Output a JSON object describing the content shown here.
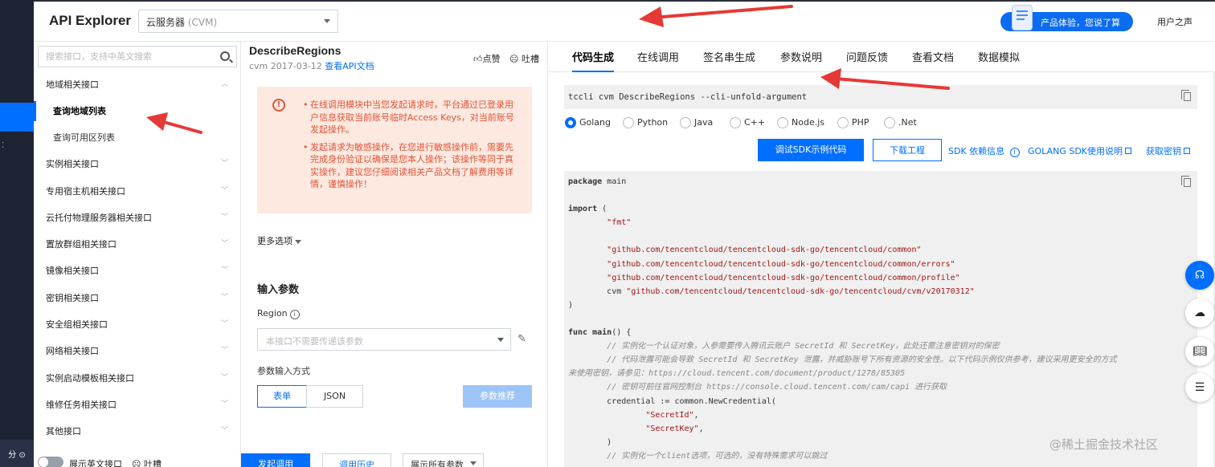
{
  "header": {
    "brand": "API Explorer",
    "product_select": {
      "name": "云服务器",
      "code": "(CVM)"
    },
    "feedback_pill": "产品体验，您说了算",
    "user_voice": "用户之声"
  },
  "left_nav": {
    "search_placeholder": "搜索接口，支持中英文搜索",
    "groups": [
      {
        "label": "地域相关接口",
        "expanded": true
      },
      {
        "label": "实例相关接口"
      },
      {
        "label": "专用宿主机相关接口"
      },
      {
        "label": "云托付物理服务器相关接口"
      },
      {
        "label": "置放群组相关接口"
      },
      {
        "label": "镜像相关接口"
      },
      {
        "label": "密钥相关接口"
      },
      {
        "label": "安全组相关接口"
      },
      {
        "label": "网络相关接口"
      },
      {
        "label": "实例启动模板相关接口"
      },
      {
        "label": "维修任务相关接口"
      },
      {
        "label": "其他接口"
      }
    ],
    "sub_items": [
      {
        "label": "查询地域列表",
        "selected": true
      },
      {
        "label": "查询可用区列表"
      }
    ],
    "footer": {
      "toggle_label": "展示英文接口",
      "tucao": "吐槽"
    }
  },
  "console_bar": {
    "bottom_text": "分 ⊙"
  },
  "request_panel": {
    "api_name": "DescribeRegions",
    "api_meta": "cvm 2017-03-12",
    "doc_link": "查看API文档",
    "like": "点赞",
    "tucao": "吐槽",
    "warnings": [
      "在线调用模块中当您发起请求时，平台通过已登录用户信息获取当前账号临时Access Keys，对当前账号发起操作。",
      "发起请求为敏感操作，在您进行敏感操作前，需要先完成身份验证以确保是您本人操作；该操作等同于真实操作，建议您仔细阅读相关产品文档了解费用等详情，谨慎操作！"
    ],
    "more_options": "更多选项",
    "input_title": "输入参数",
    "region_label": "Region",
    "region_placeholder": "本接口不需要传递该参数",
    "input_mode_label": "参数输入方式",
    "mode_form": "表单",
    "mode_json": "JSON",
    "recommend_btn": "参数推荐",
    "send_btn": "发起调用",
    "history_btn": "调用历史",
    "show_all": "展示所有参数"
  },
  "right_panel": {
    "tabs": [
      "代码生成",
      "在线调用",
      "签名串生成",
      "参数说明",
      "问题反馈",
      "查看文档",
      "数据模拟"
    ],
    "active_tab": "代码生成",
    "cli_command": "tccli cvm DescribeRegions --cli-unfold-argument",
    "languages": [
      "Golang",
      "Python",
      "Java",
      "C++",
      "Node.js",
      "PHP",
      ".Net"
    ],
    "selected_language": "Golang",
    "demo_btn": "调试SDK示例代码",
    "download_btn": "下载工程",
    "sdk_dep": "SDK 依赖信息",
    "sdk_doc": "GOLANG SDK使用说明",
    "get_key": "获取密钥",
    "code_lines": [
      {
        "t": "kw",
        "s": "package",
        "r": " main"
      },
      {
        "t": "blank"
      },
      {
        "t": "kw",
        "s": "import",
        "r": " ("
      },
      {
        "t": "str",
        "i": "        ",
        "s": "\"fmt\""
      },
      {
        "t": "blank"
      },
      {
        "t": "str",
        "i": "        ",
        "s": "\"github.com/tencentcloud/tencentcloud-sdk-go/tencentcloud/common\""
      },
      {
        "t": "str",
        "i": "        ",
        "s": "\"github.com/tencentcloud/tencentcloud-sdk-go/tencentcloud/common/errors\""
      },
      {
        "t": "str",
        "i": "        ",
        "s": "\"github.com/tencentcloud/tencentcloud-sdk-go/tencentcloud/common/profile\""
      },
      {
        "t": "mix",
        "i": "        ",
        "p": "cvm ",
        "s": "\"github.com/tencentcloud/tencentcloud-sdk-go/tencentcloud/cvm/v20170312\""
      },
      {
        "t": "plain",
        "s": ")"
      },
      {
        "t": "blank"
      },
      {
        "t": "func",
        "s": "func",
        "n": "main",
        "r": "() {"
      },
      {
        "t": "cm",
        "i": "        ",
        "s": "// 实例化一个认证对象，入参需要传入腾讯云账户 SecretId 和 SecretKey，此处还需注意密钥对的保密"
      },
      {
        "t": "cm",
        "i": "        ",
        "s": "// 代码泄露可能会导致 SecretId 和 SecretKey 泄露，并威胁账号下所有资源的安全性。以下代码示例仅供参考，建议采用更安全的方式"
      },
      {
        "t": "cm",
        "i": "",
        "s": "来使用密钥，请参见：https://cloud.tencent.com/document/product/1278/85305"
      },
      {
        "t": "cm",
        "i": "        ",
        "s": "// 密钥可前往官网控制台 https://console.cloud.tencent.com/cam/capi 进行获取"
      },
      {
        "t": "plain",
        "s": "        credential := common.NewCredential("
      },
      {
        "t": "str",
        "i": "                ",
        "s": "\"SecretId\"",
        "r": ","
      },
      {
        "t": "str",
        "i": "                ",
        "s": "\"SecretKey\"",
        "r": ","
      },
      {
        "t": "plain",
        "s": "        )"
      },
      {
        "t": "cm",
        "i": "        ",
        "s": "// 实例化一个client选项，可选的，没有特殊需求可以跳过"
      }
    ]
  },
  "watermark": "@稀土掘金技术社区",
  "colors": {
    "primary": "#006eff",
    "warning_bg": "#fde9df",
    "warning_text": "#e2533a",
    "annotation_arrow": "#e53935"
  }
}
